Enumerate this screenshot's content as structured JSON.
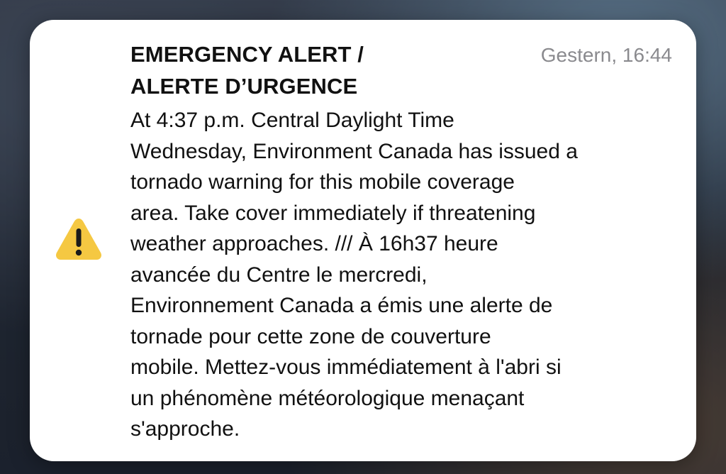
{
  "alert": {
    "title": "EMERGENCY ALERT /\nALERTE D’URGENCE",
    "timestamp": "Gestern, 16:44",
    "icon": "warning-icon",
    "icon_color": "#F5C842",
    "message_lines": [
      "At 4:37 p.m. Central Daylight Time",
      "Wednesday, Environment Canada has issued a",
      "tornado warning for this mobile coverage",
      "area. Take cover immediately if threatening",
      "weather approaches. /// À 16h37 heure",
      "avancée du Centre le mercredi,",
      "Environnement Canada a émis une alerte de",
      "tornade pour cette zone de couverture",
      "mobile. Mettez-vous immédiatement à l'abri si",
      "un phénomène météorologique menaçant",
      "s'approche."
    ]
  }
}
